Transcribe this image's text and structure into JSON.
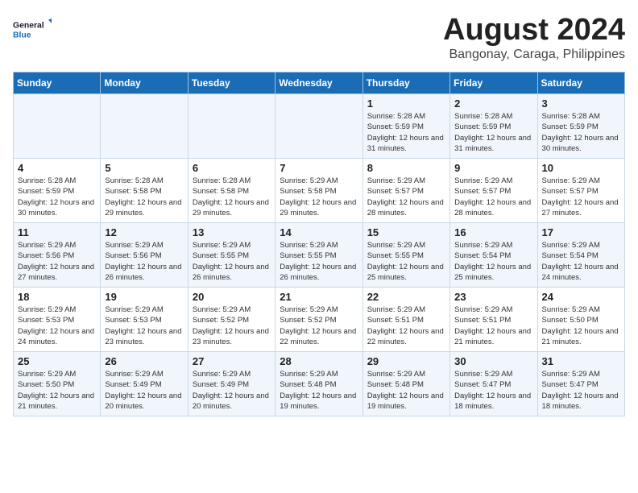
{
  "logo": {
    "line1": "General",
    "line2": "Blue"
  },
  "title": "August 2024",
  "subtitle": "Bangonay, Caraga, Philippines",
  "weekdays": [
    "Sunday",
    "Monday",
    "Tuesday",
    "Wednesday",
    "Thursday",
    "Friday",
    "Saturday"
  ],
  "weeks": [
    [
      {
        "day": "",
        "info": ""
      },
      {
        "day": "",
        "info": ""
      },
      {
        "day": "",
        "info": ""
      },
      {
        "day": "",
        "info": ""
      },
      {
        "day": "1",
        "info": "Sunrise: 5:28 AM\nSunset: 5:59 PM\nDaylight: 12 hours\nand 31 minutes."
      },
      {
        "day": "2",
        "info": "Sunrise: 5:28 AM\nSunset: 5:59 PM\nDaylight: 12 hours\nand 31 minutes."
      },
      {
        "day": "3",
        "info": "Sunrise: 5:28 AM\nSunset: 5:59 PM\nDaylight: 12 hours\nand 30 minutes."
      }
    ],
    [
      {
        "day": "4",
        "info": "Sunrise: 5:28 AM\nSunset: 5:59 PM\nDaylight: 12 hours\nand 30 minutes."
      },
      {
        "day": "5",
        "info": "Sunrise: 5:28 AM\nSunset: 5:58 PM\nDaylight: 12 hours\nand 29 minutes."
      },
      {
        "day": "6",
        "info": "Sunrise: 5:28 AM\nSunset: 5:58 PM\nDaylight: 12 hours\nand 29 minutes."
      },
      {
        "day": "7",
        "info": "Sunrise: 5:29 AM\nSunset: 5:58 PM\nDaylight: 12 hours\nand 29 minutes."
      },
      {
        "day": "8",
        "info": "Sunrise: 5:29 AM\nSunset: 5:57 PM\nDaylight: 12 hours\nand 28 minutes."
      },
      {
        "day": "9",
        "info": "Sunrise: 5:29 AM\nSunset: 5:57 PM\nDaylight: 12 hours\nand 28 minutes."
      },
      {
        "day": "10",
        "info": "Sunrise: 5:29 AM\nSunset: 5:57 PM\nDaylight: 12 hours\nand 27 minutes."
      }
    ],
    [
      {
        "day": "11",
        "info": "Sunrise: 5:29 AM\nSunset: 5:56 PM\nDaylight: 12 hours\nand 27 minutes."
      },
      {
        "day": "12",
        "info": "Sunrise: 5:29 AM\nSunset: 5:56 PM\nDaylight: 12 hours\nand 26 minutes."
      },
      {
        "day": "13",
        "info": "Sunrise: 5:29 AM\nSunset: 5:55 PM\nDaylight: 12 hours\nand 26 minutes."
      },
      {
        "day": "14",
        "info": "Sunrise: 5:29 AM\nSunset: 5:55 PM\nDaylight: 12 hours\nand 26 minutes."
      },
      {
        "day": "15",
        "info": "Sunrise: 5:29 AM\nSunset: 5:55 PM\nDaylight: 12 hours\nand 25 minutes."
      },
      {
        "day": "16",
        "info": "Sunrise: 5:29 AM\nSunset: 5:54 PM\nDaylight: 12 hours\nand 25 minutes."
      },
      {
        "day": "17",
        "info": "Sunrise: 5:29 AM\nSunset: 5:54 PM\nDaylight: 12 hours\nand 24 minutes."
      }
    ],
    [
      {
        "day": "18",
        "info": "Sunrise: 5:29 AM\nSunset: 5:53 PM\nDaylight: 12 hours\nand 24 minutes."
      },
      {
        "day": "19",
        "info": "Sunrise: 5:29 AM\nSunset: 5:53 PM\nDaylight: 12 hours\nand 23 minutes."
      },
      {
        "day": "20",
        "info": "Sunrise: 5:29 AM\nSunset: 5:52 PM\nDaylight: 12 hours\nand 23 minutes."
      },
      {
        "day": "21",
        "info": "Sunrise: 5:29 AM\nSunset: 5:52 PM\nDaylight: 12 hours\nand 22 minutes."
      },
      {
        "day": "22",
        "info": "Sunrise: 5:29 AM\nSunset: 5:51 PM\nDaylight: 12 hours\nand 22 minutes."
      },
      {
        "day": "23",
        "info": "Sunrise: 5:29 AM\nSunset: 5:51 PM\nDaylight: 12 hours\nand 21 minutes."
      },
      {
        "day": "24",
        "info": "Sunrise: 5:29 AM\nSunset: 5:50 PM\nDaylight: 12 hours\nand 21 minutes."
      }
    ],
    [
      {
        "day": "25",
        "info": "Sunrise: 5:29 AM\nSunset: 5:50 PM\nDaylight: 12 hours\nand 21 minutes."
      },
      {
        "day": "26",
        "info": "Sunrise: 5:29 AM\nSunset: 5:49 PM\nDaylight: 12 hours\nand 20 minutes."
      },
      {
        "day": "27",
        "info": "Sunrise: 5:29 AM\nSunset: 5:49 PM\nDaylight: 12 hours\nand 20 minutes."
      },
      {
        "day": "28",
        "info": "Sunrise: 5:29 AM\nSunset: 5:48 PM\nDaylight: 12 hours\nand 19 minutes."
      },
      {
        "day": "29",
        "info": "Sunrise: 5:29 AM\nSunset: 5:48 PM\nDaylight: 12 hours\nand 19 minutes."
      },
      {
        "day": "30",
        "info": "Sunrise: 5:29 AM\nSunset: 5:47 PM\nDaylight: 12 hours\nand 18 minutes."
      },
      {
        "day": "31",
        "info": "Sunrise: 5:29 AM\nSunset: 5:47 PM\nDaylight: 12 hours\nand 18 minutes."
      }
    ]
  ]
}
